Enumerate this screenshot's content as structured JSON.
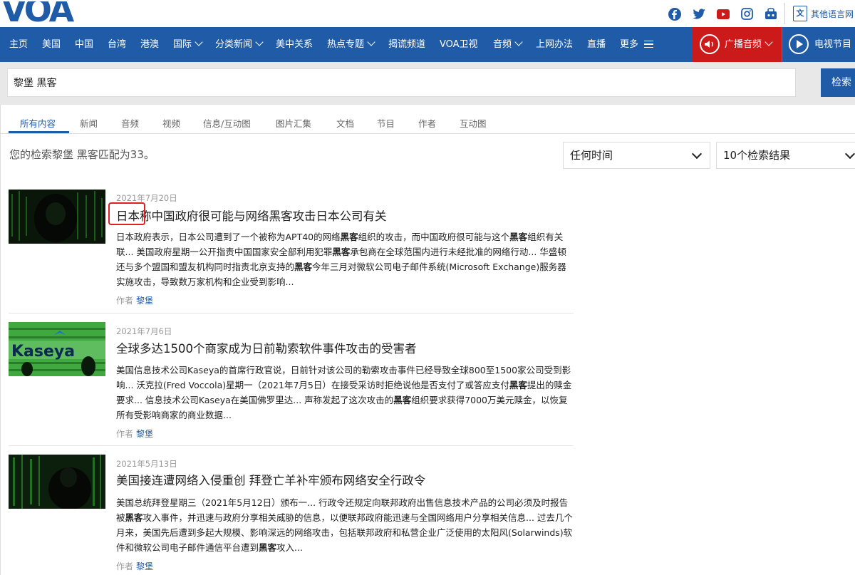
{
  "brand": {
    "logo_text": "VOA",
    "brand_color": "#1f5ba7",
    "alert_color": "#cc1a1a"
  },
  "social_icons": [
    "facebook-icon",
    "twitter-icon",
    "youtube-icon",
    "instagram-icon",
    "podcast-icon"
  ],
  "language": {
    "label": "其他语言网"
  },
  "nav": {
    "items": [
      {
        "label": "主页"
      },
      {
        "label": "美国"
      },
      {
        "label": "中国"
      },
      {
        "label": "台湾"
      },
      {
        "label": "港澳"
      },
      {
        "label": "国际",
        "dropdown": true
      },
      {
        "label": "分类新闻",
        "dropdown": true
      },
      {
        "label": "美中关系"
      },
      {
        "label": "热点专题",
        "dropdown": true
      },
      {
        "label": "揭谎频道"
      },
      {
        "label": "VOA卫视"
      },
      {
        "label": "音频",
        "dropdown": true
      },
      {
        "label": "上网办法"
      },
      {
        "label": "直播"
      },
      {
        "label": "更多",
        "menu": true
      }
    ],
    "radio_label": "广播音频",
    "tv_label": "电视节目"
  },
  "search": {
    "value": "黎堡 黑客",
    "button_label": "检索"
  },
  "tabs": [
    "所有内容",
    "新闻",
    "音频",
    "视频",
    "信息/互动图",
    "图片汇集",
    "文档",
    "节目",
    "作者",
    "互动图"
  ],
  "results_summary": "您的检索黎堡 黑客匹配为33。",
  "filters": {
    "time": "任何时间",
    "count": "10个检索结果"
  },
  "results": [
    {
      "date": "2021年7月20日",
      "title": "日本称中国政府很可能与网络黑客攻击日本公司有关",
      "excerpt_html": "日本政府表示，日本公司遭到了一个被称为APT40的网络<b>黑客</b>组织的攻击，而中国政府很可能与这个<b>黑客</b>组织有关联... 美国政府星期一公开指责中国国家安全部利用犯罪<b>黑客</b>承包商在全球范围内进行未经批准的网络行动... 华盛顿还与多个盟国和盟友机构同时指责北京支持的<b>黑客</b>今年三月对微软公司电子邮件系统(Microsoft Exchange)服务器实施攻击，导致数万家机构和企业受到影响...",
      "author_prefix": "作者",
      "author": "黎堡"
    },
    {
      "date": "2021年7月6日",
      "title": "全球多达1500个商家成为日前勒索软件事件攻击的受害者",
      "excerpt_html": "美国信息技术公司Kaseya的首席行政官说，日前针对该公司的勒索攻击事件已经导致全球800至1500家公司受到影响... 沃克拉(Fred Voccola)星期一（2021年7月5日）在接受采访时拒绝说他是否支付了或答应支付<b>黑客</b>提出的赎金要求... 信息技术公司Kaseya在美国佛罗里达... 声称发起了这次攻击的<b>黑客</b>组织要求获得7000万美元赎金，以恢复所有受影响商家的商业数据...",
      "author_prefix": "作者",
      "author": "黎堡",
      "thumb_text": "Kaseya"
    },
    {
      "date": "2021年5月13日",
      "title": "美国接连遭网络入侵重创 拜登亡羊补牢颁布网络安全行政令",
      "excerpt_html": "美国总统拜登星期三（2021年5月12日）颁布一... 行政令还规定向联邦政府出售信息技术产品的公司必须及时报告被<b>黑客</b>攻入事件，并迅速与政府分享相关威胁的信息，以便联邦政府能迅速与全国网络用户分享相关信息... 过去几个月来，美国先后遭到多起大规模、影响深远的网络攻击，包括联邦政府和私营企业广泛使用的太阳风(Solarwinds)软件和微软公司电子邮件通信平台遭到<b>黑客</b>攻入...",
      "author_prefix": "作者",
      "author": "黎堡"
    }
  ]
}
